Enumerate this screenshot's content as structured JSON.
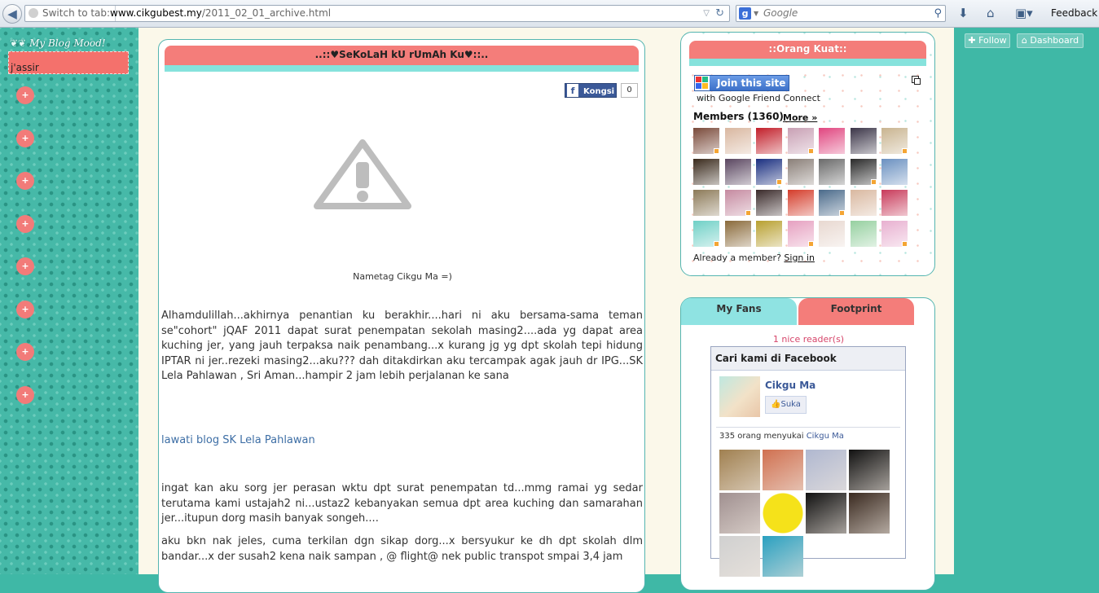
{
  "browser": {
    "back_glyph": "◀",
    "url_prefix": "Switch to tab:",
    "url_host": "www.cikgubest.my",
    "url_path": "/2011_02_01_archive.html",
    "search_engine_glyph": "g",
    "search_placeholder": "Google",
    "feedback_label": "Feedback"
  },
  "left": {
    "mood_title": "My Blog Mood!",
    "mood_value": "j'assir",
    "circle_buttons": [
      "+",
      "+",
      "+",
      "+",
      "+",
      "+",
      "+",
      "+"
    ]
  },
  "post": {
    "title": "..::♥SeKoLaH kU rUmAh Ku♥::..",
    "share_label": "Kongsi",
    "share_count": "0",
    "image_caption": "Nametag Cikgu Ma =)",
    "paragraph1": " Alhamdulillah...akhirnya penantian ku berakhir....hari ni aku bersama-sama teman se\"cohort\" jQAF 2011 dapat surat penempatan sekolah masing2....ada yg dapat area kuching jer, yang jauh terpaksa naik penambang...x kurang jg yg dpt skolah tepi hidung IPTAR ni jer..rezeki masing2...aku??? dah ditakdirkan aku tercampak agak jauh dr IPG...SK Lela Pahlawan , Sri Aman...hampir 2 jam lebih perjalanan ke sana",
    "link_text": "lawati blog SK Lela Pahlawan",
    "paragraph2": "ingat kan aku sorg jer perasan wktu dpt surat penempatan td...mmg ramai yg sedar terutama kami ustajah2 ni...ustaz2 kebanyakan semua dpt area kuching dan samarahan jer...itupun dorg masih banyak songeh....",
    "paragraph3": "aku bkn nak jeles, cuma terkilan dgn sikap dorg...x bersyukur ke dh dpt skolah dlm bandar...x der susah2 kena naik sampan , @ flight@ nek public transpot smpai 3,4 jam"
  },
  "sidebar": {
    "followers_title": "::Orang Kuat::",
    "join_label": "Join this site",
    "gfc_subtitle": "with Google Friend Connect",
    "members_label": "Members (1360)",
    "more_label": "More »",
    "already_text": "Already a member?",
    "sign_in_label": "Sign in",
    "avatar_colors": [
      "#7a4a3a",
      "#d9b7a0",
      "#c21f2a",
      "#c8a0b4",
      "#e0457f",
      "#3b3548",
      "#c9b490",
      "#3a2a1c",
      "#5a4660",
      "#1a2f80",
      "#8a7f78",
      "#6a6a6a",
      "#2a2a2a",
      "#6a90c0",
      "#8c7a58",
      "#c58aa0",
      "#3a2a2a",
      "#d43c2a",
      "#4a6a8a",
      "#d9b8a0",
      "#c83a5a",
      "#6fd0c6",
      "#8a6a3a",
      "#b8a030",
      "#e6a0c0",
      "#e8d8d0",
      "#96d0a0",
      "#e8b0d0"
    ]
  },
  "fans": {
    "tab_fans": "My Fans",
    "tab_footprint": "Footprint",
    "reader_count": "1 nice reader(s)",
    "fb_header": "Cari kami di Facebook",
    "fb_page_name": "Cikgu Ma",
    "fb_like_label": "Suka",
    "fb_count_prefix": "335 orang menyukai",
    "fb_count_page": "Cikgu Ma",
    "fan_colors": [
      "#a08050",
      "#d07050",
      "#b0b8d0",
      "#111111",
      "#a09090",
      "#f2e31a",
      "#111111",
      "#3a2a20",
      "#d0d0d0",
      "#2aa0c0"
    ]
  }
}
